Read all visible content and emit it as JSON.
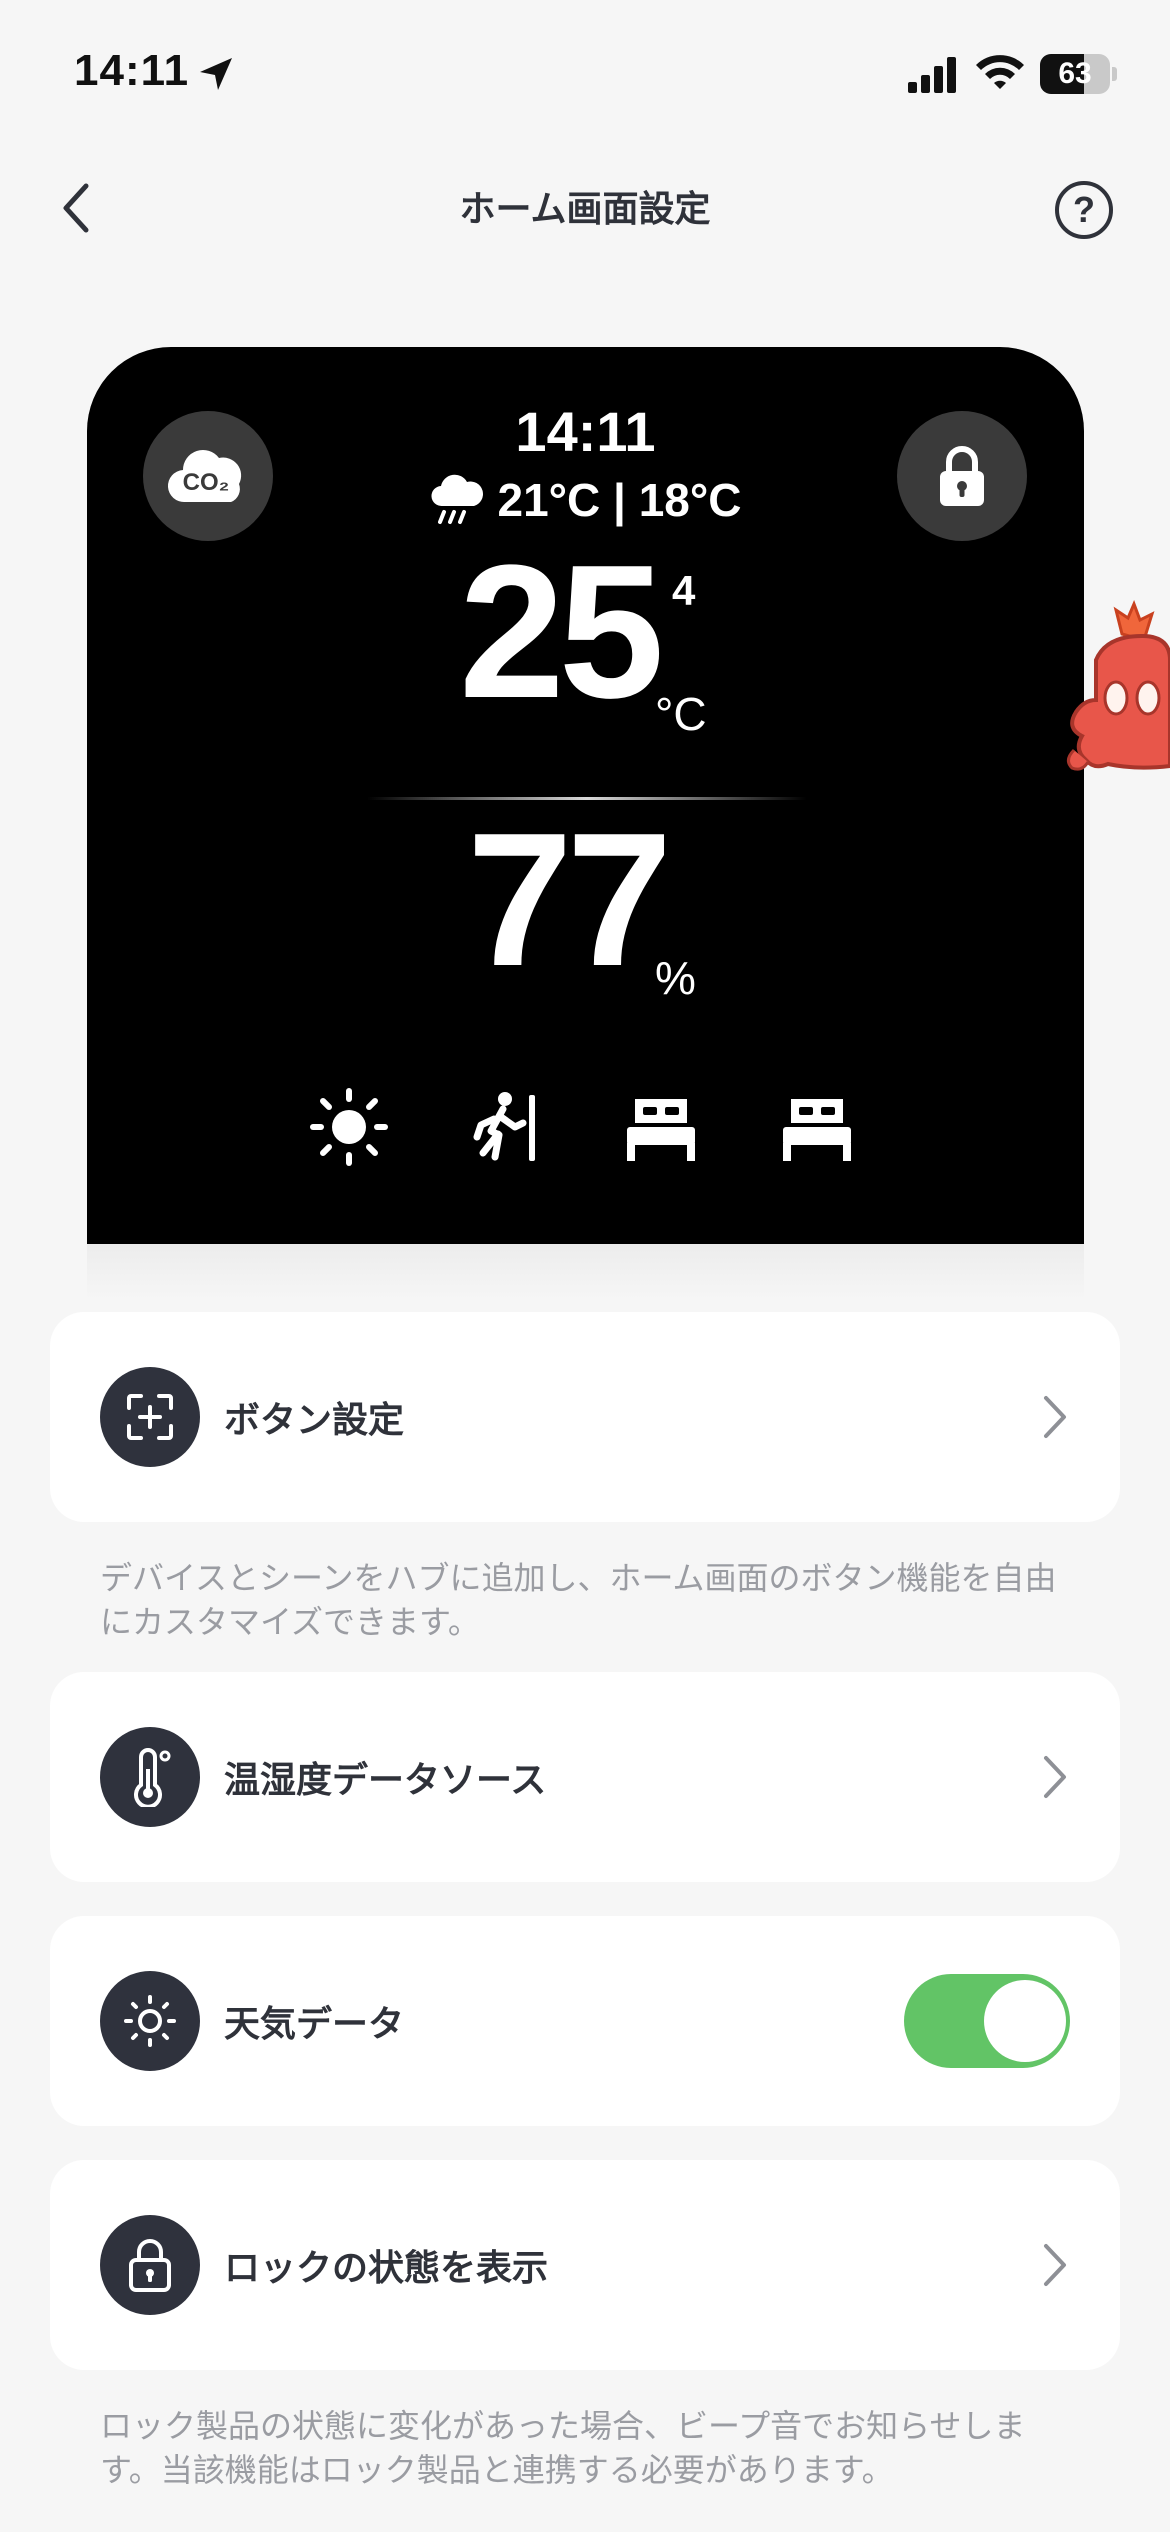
{
  "status_bar": {
    "time": "14:11",
    "battery_percent": 63,
    "battery_label": "63"
  },
  "nav": {
    "title": "ホーム画面設定",
    "help_label": "?"
  },
  "preview": {
    "co2_label": "CO₂",
    "clock": "14:11",
    "weather": "21°C | 18°C",
    "temperature_int": "25",
    "temperature_dec": "4",
    "temperature_unit": "°C",
    "humidity": "77",
    "humidity_unit": "%",
    "scene_icons": [
      "sun-icon",
      "leave-home-icon",
      "bed-icon",
      "bed-icon"
    ]
  },
  "settings": {
    "button_settings": {
      "label": "ボタン設定",
      "description": "デバイスとシーンをハブに追加し、ホーム画面のボタン機能を自由にカスタマイズできます。"
    },
    "temp_humidity_source": {
      "label": "温湿度データソース"
    },
    "weather_data": {
      "label": "天気データ",
      "enabled": true
    },
    "lock_status": {
      "label": "ロックの状態を表示",
      "description": "ロック製品の状態に変化があった場合、ビープ音でお知らせします。当該機能はロック製品と連携する必要があります。"
    }
  },
  "colors": {
    "toggle_on": "#62c466",
    "icon_bg": "#2f323d",
    "preview_bg": "#000000"
  }
}
